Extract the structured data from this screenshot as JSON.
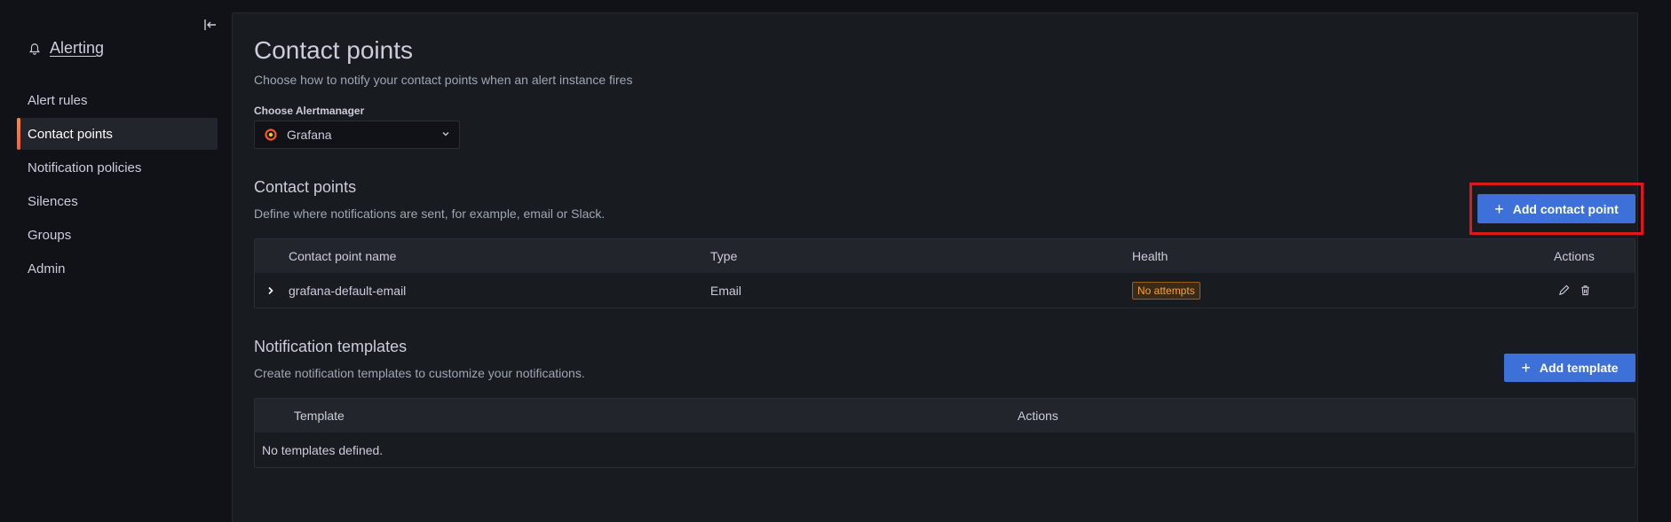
{
  "sidebar": {
    "title": "Alerting",
    "items": [
      {
        "label": "Alert rules"
      },
      {
        "label": "Contact points"
      },
      {
        "label": "Notification policies"
      },
      {
        "label": "Silences"
      },
      {
        "label": "Groups"
      },
      {
        "label": "Admin"
      }
    ]
  },
  "page": {
    "title": "Contact points",
    "subtitle": "Choose how to notify your contact points when an alert instance fires",
    "alertmanager_label": "Choose Alertmanager",
    "alertmanager_value": "Grafana"
  },
  "contact_points": {
    "title": "Contact points",
    "description": "Define where notifications are sent, for example, email or Slack.",
    "add_button": "Add contact point",
    "columns": [
      "Contact point name",
      "Type",
      "Health",
      "Actions"
    ],
    "rows": [
      {
        "name": "grafana-default-email",
        "type": "Email",
        "health": "No attempts"
      }
    ]
  },
  "templates": {
    "title": "Notification templates",
    "description": "Create notification templates to customize your notifications.",
    "add_button": "Add template",
    "columns": [
      "Template",
      "Actions"
    ],
    "empty": "No templates defined."
  },
  "colors": {
    "accent": "#3d71d9",
    "active_indicator": "#ff8833",
    "highlight": "#e01818",
    "warning": "#f8a13f"
  }
}
